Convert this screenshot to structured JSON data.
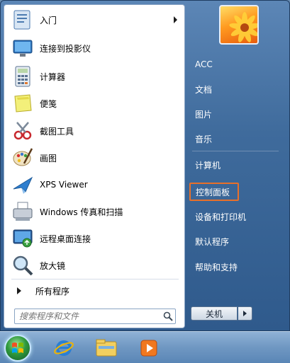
{
  "start_menu": {
    "programs": [
      {
        "label": "入门",
        "icon": "getting-started-icon",
        "has_submenu": true
      },
      {
        "label": "连接到投影仪",
        "icon": "projector-icon",
        "has_submenu": false
      },
      {
        "label": "计算器",
        "icon": "calculator-icon",
        "has_submenu": false
      },
      {
        "label": "便笺",
        "icon": "sticky-notes-icon",
        "has_submenu": false
      },
      {
        "label": "截图工具",
        "icon": "snipping-tool-icon",
        "has_submenu": false
      },
      {
        "label": "画图",
        "icon": "paint-icon",
        "has_submenu": false
      },
      {
        "label": "XPS Viewer",
        "icon": "xps-viewer-icon",
        "has_submenu": false
      },
      {
        "label": "Windows 传真和扫描",
        "icon": "fax-scan-icon",
        "has_submenu": false
      },
      {
        "label": "远程桌面连接",
        "icon": "remote-desktop-icon",
        "has_submenu": false
      },
      {
        "label": "放大镜",
        "icon": "magnifier-icon",
        "has_submenu": false
      }
    ],
    "all_programs_label": "所有程序",
    "search_placeholder": "搜索程序和文件",
    "right_items": [
      {
        "label": "ACC"
      },
      {
        "label": "文档"
      },
      {
        "label": "图片"
      },
      {
        "label": "音乐"
      },
      {
        "label": "计算机"
      },
      {
        "label": "控制面板",
        "highlighted": true
      },
      {
        "label": "设备和打印机"
      },
      {
        "label": "默认程序"
      },
      {
        "label": "帮助和支持"
      }
    ],
    "shutdown_label": "关机"
  },
  "taskbar": {
    "buttons": [
      {
        "name": "internet-explorer-icon"
      },
      {
        "name": "windows-explorer-icon"
      },
      {
        "name": "media-player-icon"
      }
    ]
  },
  "colors": {
    "highlight_border": "#e8702a",
    "menu_blue": "#3f6b9c"
  }
}
